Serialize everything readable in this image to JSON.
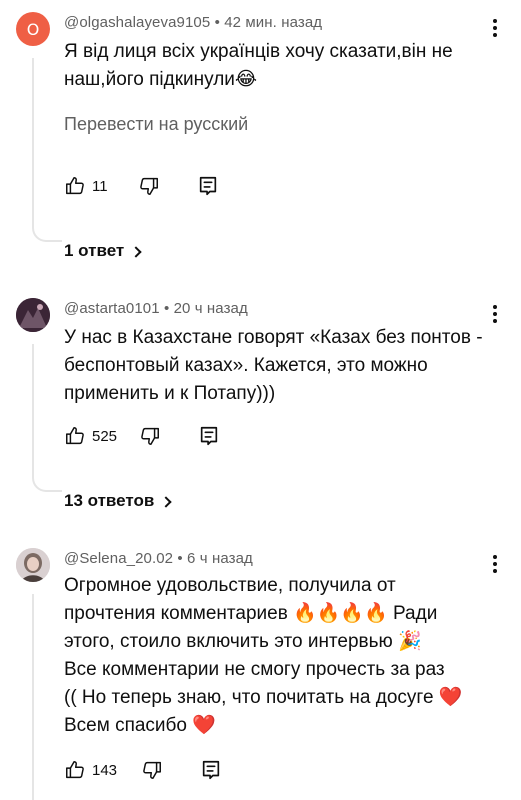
{
  "comments": [
    {
      "avatar_letter": "О",
      "author": "@olgashalayeva9105",
      "time": "42 мин. назад",
      "lines": [
        "Я від лиця всіх українців хочу сказати,він не",
        "наш,його підкинули😂"
      ],
      "translate_label": "Перевести на русский",
      "likes": "11",
      "replies_label": "1 ответ"
    },
    {
      "author": "@astarta0101",
      "time": "20 ч назад",
      "lines": [
        "У нас в Казахстане говорят «Казах без понтов -",
        "беспонтовый казах». Кажется, это можно",
        "применить и к Потапу)))"
      ],
      "likes": "525",
      "replies_label": "13 ответов"
    },
    {
      "author": "@Selena_20.02",
      "time": "6 ч назад",
      "lines": [
        "Огромное удовольствие, получила от",
        "прочтения комментариев 🔥🔥🔥🔥 Ради",
        "этого, стоило включить это интервью 🎉",
        "Все комментарии не смогу прочесть за раз",
        "(( Но теперь знаю, что почитать на досуге ❤️",
        "Всем спасибо ❤️"
      ],
      "likes": "143"
    }
  ],
  "meta_separator": "•",
  "icons": {
    "like": "thumb-up-icon",
    "dislike": "thumb-down-icon",
    "reply": "reply-icon",
    "more": "more-vert-icon",
    "chevron": "chevron-right-icon"
  },
  "colors": {
    "avatar_letter_bg": "#ef5f45",
    "secondary_text": "#606060",
    "thread_line": "#e5e5e5"
  }
}
